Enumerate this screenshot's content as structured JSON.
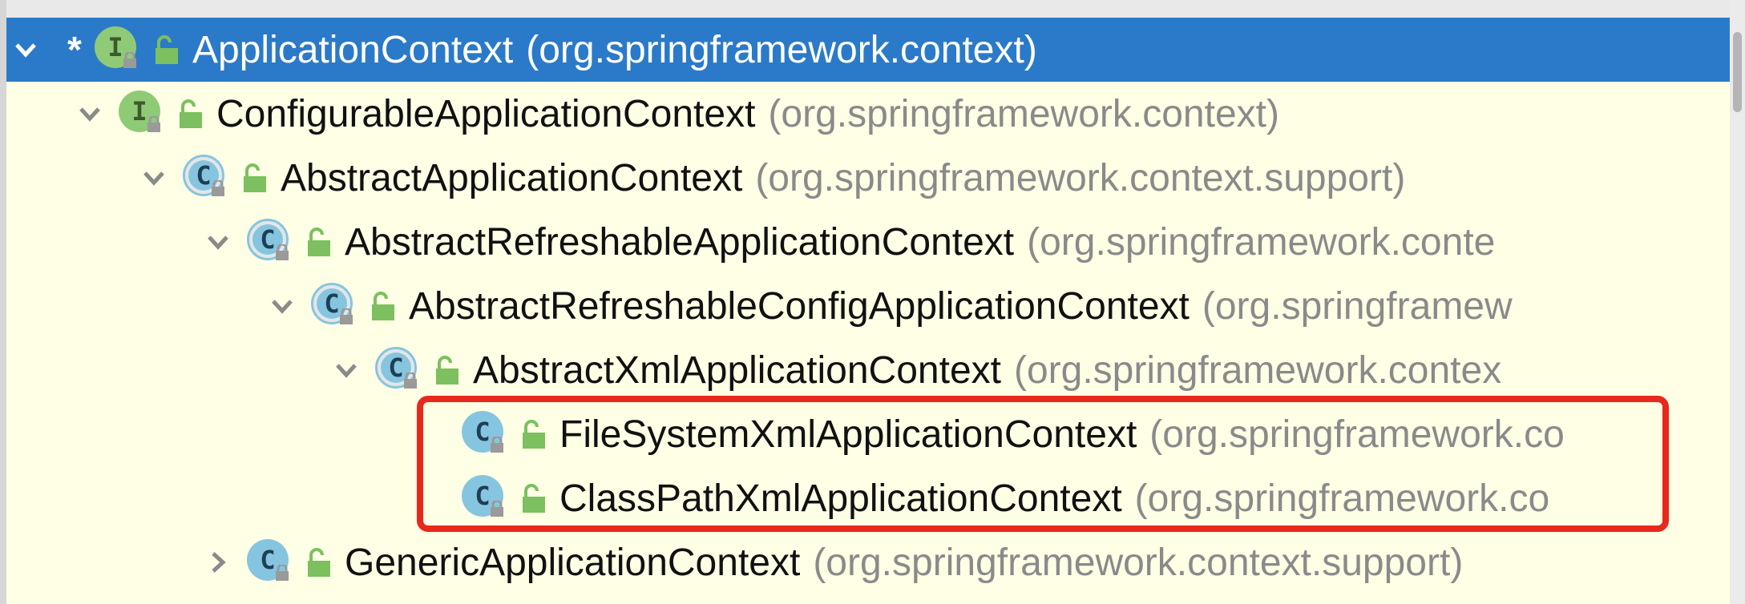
{
  "colors": {
    "background": "#ffffe6",
    "selection": "#2b7ac9",
    "interface_icon": "#8fcb76",
    "class_icon": "#86c5e0",
    "public_access": "#7cc05f",
    "package_text": "#8a8a8a",
    "highlight_border": "#e8281b"
  },
  "tree": {
    "rows": [
      {
        "kind": "interface",
        "marker": "*",
        "icon_letter": "I",
        "name": "ApplicationContext",
        "package": "(org.springframework.context)",
        "expander": "chevron-down-icon",
        "selected": true
      },
      {
        "kind": "interface",
        "icon_letter": "I",
        "name": "ConfigurableApplicationContext",
        "package": "(org.springframework.context)",
        "expander": "chevron-down-icon"
      },
      {
        "kind": "abstract-class",
        "icon_letter": "C",
        "name": "AbstractApplicationContext",
        "package": "(org.springframework.context.support)",
        "expander": "chevron-down-icon"
      },
      {
        "kind": "abstract-class",
        "icon_letter": "C",
        "name": "AbstractRefreshableApplicationContext",
        "package": "(org.springframework.conte",
        "expander": "chevron-down-icon"
      },
      {
        "kind": "abstract-class",
        "icon_letter": "C",
        "name": "AbstractRefreshableConfigApplicationContext",
        "package": "(org.springframew",
        "expander": "chevron-down-icon"
      },
      {
        "kind": "abstract-class",
        "icon_letter": "C",
        "name": "AbstractXmlApplicationContext",
        "package": "(org.springframework.contex",
        "expander": "chevron-down-icon"
      },
      {
        "kind": "class",
        "icon_letter": "C",
        "name": "FileSystemXmlApplicationContext",
        "package": "(org.springframework.co",
        "expander": "none"
      },
      {
        "kind": "class",
        "icon_letter": "C",
        "name": "ClassPathXmlApplicationContext",
        "package": "(org.springframework.co",
        "expander": "none"
      },
      {
        "kind": "class",
        "icon_letter": "C",
        "name": "GenericApplicationContext",
        "package": "(org.springframework.context.support)",
        "expander": "chevron-right-icon"
      }
    ]
  }
}
